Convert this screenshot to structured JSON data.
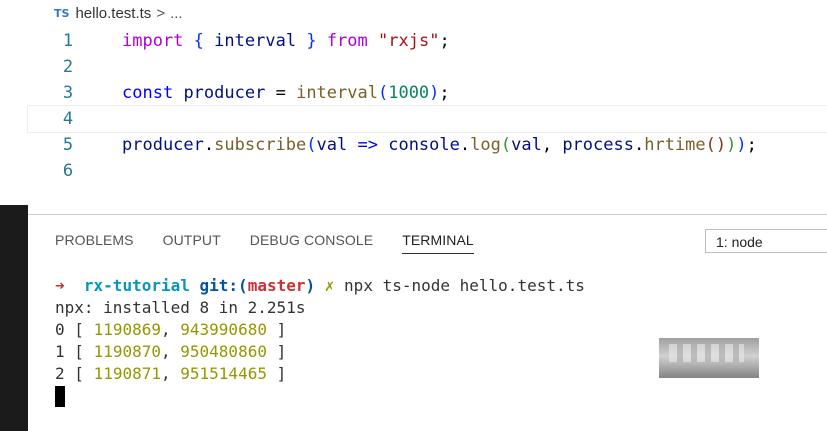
{
  "breadcrumb": {
    "badge": "TS",
    "file": "hello.test.ts",
    "separator": ">",
    "ellipsis": "..."
  },
  "editor": {
    "lines": [
      {
        "number": "1"
      },
      {
        "number": "2"
      },
      {
        "number": "3"
      },
      {
        "number": "4"
      },
      {
        "number": "5"
      },
      {
        "number": "6"
      }
    ],
    "tokens": {
      "l1_import": "import",
      "l1_brace_open": "{",
      "l1_interval": "interval",
      "l1_brace_close": "}",
      "l1_from": "from",
      "l1_module": "\"rxjs\"",
      "l1_semi": ";",
      "l3_const": "const",
      "l3_producer": "producer",
      "l3_eq": "=",
      "l3_interval": "interval",
      "l3_paren_open": "(",
      "l3_num": "1000",
      "l3_paren_close": ")",
      "l3_semi": ";",
      "l5_producer": "producer",
      "l5_dot1": ".",
      "l5_subscribe": "subscribe",
      "l5_paren1": "(",
      "l5_val": "val",
      "l5_arrow": "=>",
      "l5_console": "console",
      "l5_dot2": ".",
      "l5_log": "log",
      "l5_paren2": "(",
      "l5_val2": "val",
      "l5_comma": ",",
      "l5_process": "process",
      "l5_dot3": ".",
      "l5_hrtime": "hrtime",
      "l5_paren3": "()",
      "l5_close2": ")",
      "l5_close1": ")",
      "l5_semi": ";"
    }
  },
  "panel": {
    "tabs": [
      {
        "label": "PROBLEMS"
      },
      {
        "label": "OUTPUT"
      },
      {
        "label": "DEBUG CONSOLE"
      },
      {
        "label": "TERMINAL"
      }
    ],
    "terminal_select": "1: node"
  },
  "terminal": {
    "prompt_arrow": "➜",
    "dir": "rx-tutorial",
    "git_label": "git:(",
    "branch": "master",
    "git_close": ")",
    "dirty_mark": "✗",
    "command": "npx ts-node hello.test.ts",
    "installed": "npx: installed 8 in 2.251s",
    "output": [
      {
        "index": "0",
        "open": "[",
        "a": "1190869",
        "b": "943990680",
        "close": "]"
      },
      {
        "index": "1",
        "open": "[",
        "a": "1190870",
        "b": "950480860",
        "close": "]"
      },
      {
        "index": "2",
        "open": "[",
        "a": "1190871",
        "b": "951514465",
        "close": "]"
      }
    ]
  },
  "colors": {
    "keyword": "#af00db",
    "string": "#a31515",
    "number": "#098658",
    "function": "#795e26",
    "variable": "#001080",
    "line_number": "#237893",
    "terminal_red": "#cd3131",
    "terminal_cyan": "#0598bc",
    "terminal_yellow": "#949800"
  }
}
